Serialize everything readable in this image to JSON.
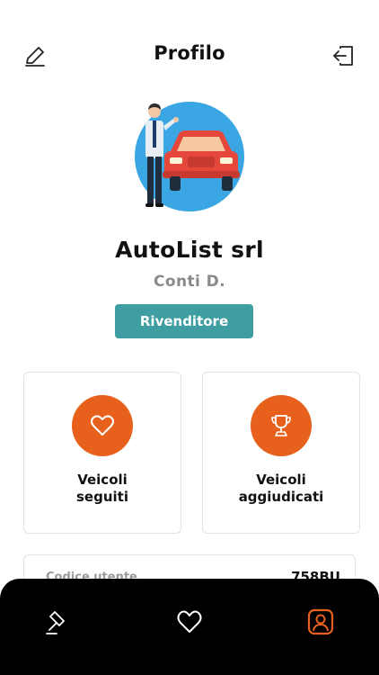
{
  "header": {
    "title": "Profilo",
    "edit_icon": "pencil-icon",
    "logout_icon": "logout-icon"
  },
  "profile": {
    "company": "AutoList srl",
    "person": "Conti D.",
    "role": "Rivenditore"
  },
  "cards": [
    {
      "icon": "heart-icon",
      "label": "Veicoli\nseguiti"
    },
    {
      "icon": "trophy-icon",
      "label": "Veicoli\naggiudicati"
    }
  ],
  "info": {
    "key": "Codice utente",
    "value": "758BU"
  },
  "tabbar": {
    "items": [
      {
        "icon": "gavel-icon",
        "active": false
      },
      {
        "icon": "heart-icon",
        "active": false
      },
      {
        "icon": "profile-icon",
        "active": true
      }
    ]
  },
  "colors": {
    "accent_orange": "#e8611c",
    "badge_teal": "#3e9ea1",
    "tabbar_bg": "#000000",
    "avatar_blue": "#3aa6e3",
    "car_red": "#e5483b"
  }
}
